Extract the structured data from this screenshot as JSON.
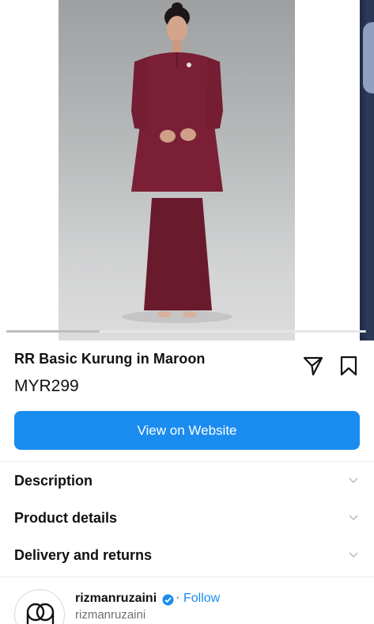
{
  "carousel": {
    "current_index": 1,
    "total_images": 3,
    "progress_fraction": 0.26
  },
  "product": {
    "title": "RR Basic Kurung in Maroon",
    "price": "MYR299"
  },
  "actions": {
    "share_icon": "paper-plane-icon",
    "save_icon": "bookmark-icon"
  },
  "cta": {
    "label": "View on Website",
    "color": "#1a8cf0"
  },
  "accordion": [
    {
      "label": "Description"
    },
    {
      "label": "Product details"
    },
    {
      "label": "Delivery and returns"
    }
  ],
  "seller": {
    "name": "rizmanruzaini",
    "verified": true,
    "separator": "·",
    "follow_label": "Follow",
    "handle": "rizmanruzaini"
  },
  "colors": {
    "garment": "#7a1f35",
    "accent": "#1a8cf0"
  }
}
